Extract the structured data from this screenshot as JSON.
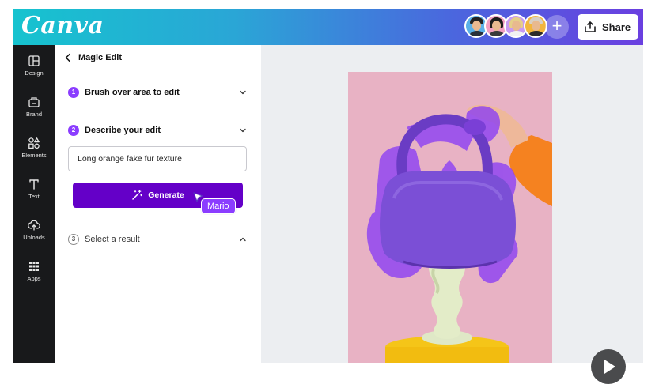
{
  "app": {
    "logo_text": "Canva"
  },
  "header": {
    "share_label": "Share",
    "add_collaborator": "+",
    "avatars": [
      {
        "name": "avatar-1",
        "bg": "#5ab0e8",
        "hair": "#222222",
        "shirt": "#2a2f3a"
      },
      {
        "name": "avatar-2",
        "bg": "#f29fc2",
        "hair": "#1c1c1c",
        "shirt": "#3b3b3b"
      },
      {
        "name": "avatar-3",
        "bg": "#c79af2",
        "hair": "#e5cf8a",
        "shirt": "#f2f2f2"
      },
      {
        "name": "avatar-4",
        "bg": "#f2b63d",
        "hair": "#d8d0c4",
        "shirt": "#2b2b2b"
      }
    ]
  },
  "rail": {
    "items": [
      {
        "label": "Design",
        "icon": "layout-icon"
      },
      {
        "label": "Brand",
        "icon": "brand-icon"
      },
      {
        "label": "Elements",
        "icon": "elements-icon"
      },
      {
        "label": "Text",
        "icon": "text-icon"
      },
      {
        "label": "Uploads",
        "icon": "upload-icon"
      },
      {
        "label": "Apps",
        "icon": "apps-icon"
      }
    ]
  },
  "panel": {
    "title": "Magic Edit",
    "steps": [
      {
        "number": "1",
        "label": "Brush over area to edit",
        "state": "done"
      },
      {
        "number": "2",
        "label": "Describe your edit",
        "state": "active"
      },
      {
        "number": "3",
        "label": "Select a result",
        "state": "pending"
      }
    ],
    "prompt_value": "Long orange fake fur texture",
    "generate_label": "Generate",
    "collaborator_cursor_name": "Mario"
  },
  "colors": {
    "accent": "#8b3dff",
    "generate_button": "#6400c8",
    "brush_overlay": "#8a3df5",
    "artboard_bg": "#e8b2c4"
  }
}
